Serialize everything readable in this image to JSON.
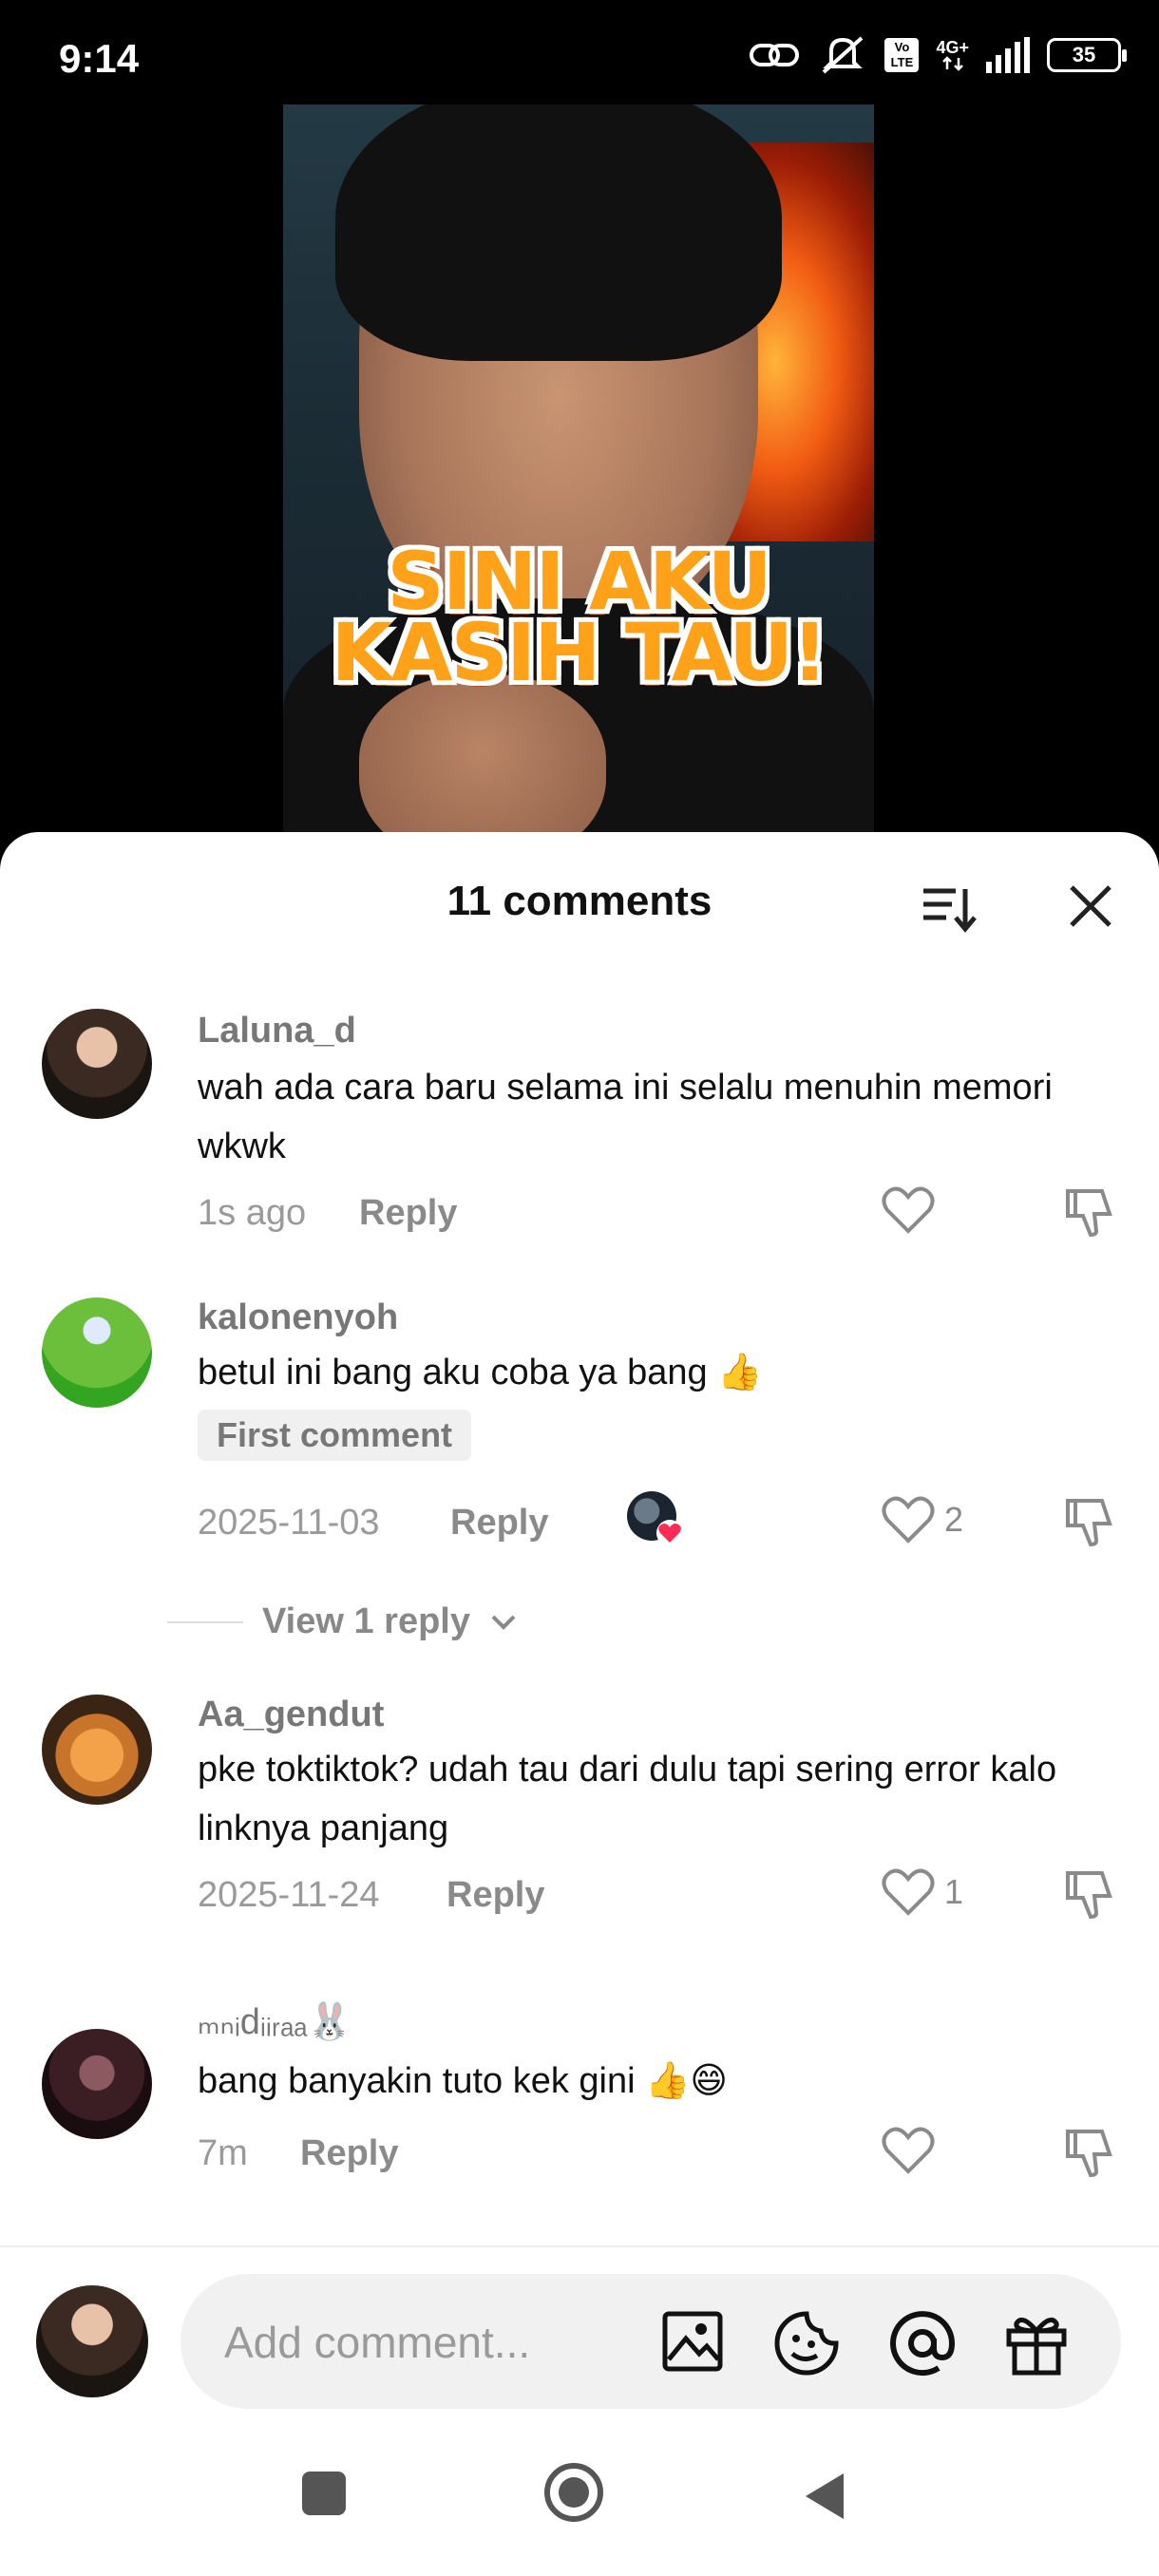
{
  "status_bar": {
    "time": "9:14",
    "network": "4G+",
    "volte": "Vo LTE",
    "battery": "35"
  },
  "video": {
    "caption_line1": "SINI AKU",
    "caption_line2": "KASIH TAU!"
  },
  "sheet": {
    "title": "11 comments"
  },
  "comments": [
    {
      "username": "Laluna_d",
      "text": "wah ada cara baru selama ini selalu menuhin memori wkwk",
      "time": "1s ago",
      "reply_label": "Reply",
      "likes": ""
    },
    {
      "username": "kalonenyoh",
      "text": "betul ini bang aku coba ya bang 👍",
      "badge": "First comment",
      "time": "2025-11-03",
      "reply_label": "Reply",
      "likes": "2",
      "view_replies": "View 1 reply"
    },
    {
      "username": "Aa_gendut",
      "text": "pke toktiktok? udah tau dari dulu tapi sering error kalo linknya panjang",
      "time": "2025-11-24",
      "reply_label": "Reply",
      "likes": "1"
    },
    {
      "username": "ₘₙᵢdᵢᵢᵣₐₐ🐰",
      "text": "bang banyakin tuto kek gini 👍😄",
      "time": "7m",
      "reply_label": "Reply",
      "likes": ""
    }
  ],
  "input": {
    "placeholder": "Add comment..."
  },
  "colors": {
    "accent_heart": "#fe2c55",
    "caption_orange": "#ffa21a"
  },
  "icons": [
    "link-icon",
    "mute-icon",
    "signal-icon",
    "sort-icon",
    "close-icon",
    "heart-icon",
    "dislike-icon",
    "chevron-down-icon",
    "image-icon",
    "emoji-icon",
    "mention-icon",
    "gift-icon",
    "recents-icon",
    "home-icon",
    "back-icon"
  ]
}
